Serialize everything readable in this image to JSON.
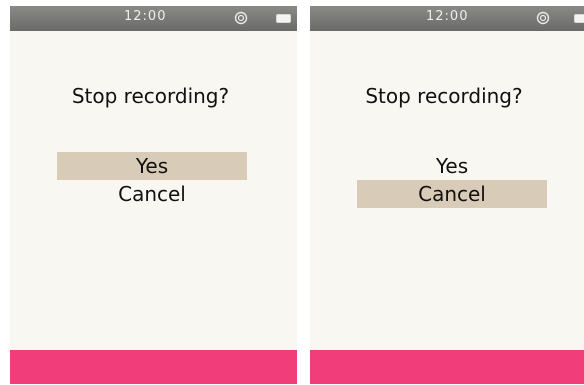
{
  "screens": [
    {
      "status": {
        "time": "12:00",
        "icon": "target-icon",
        "battery": "battery-icon"
      },
      "dialog": {
        "question": "Stop recording?",
        "options": [
          "Yes",
          "Cancel"
        ],
        "selected": "Yes"
      }
    },
    {
      "status": {
        "time": "12:00",
        "icon": "target-icon",
        "battery": "battery-icon"
      },
      "dialog": {
        "question": "Stop recording?",
        "options": [
          "Yes",
          "Cancel"
        ],
        "selected": "Cancel"
      }
    }
  ],
  "colors": {
    "status_bar": "#767673",
    "screen_background": "#f8f7f1",
    "selection": "#d8cbb7",
    "bottom_bar": "#f13d7a"
  }
}
